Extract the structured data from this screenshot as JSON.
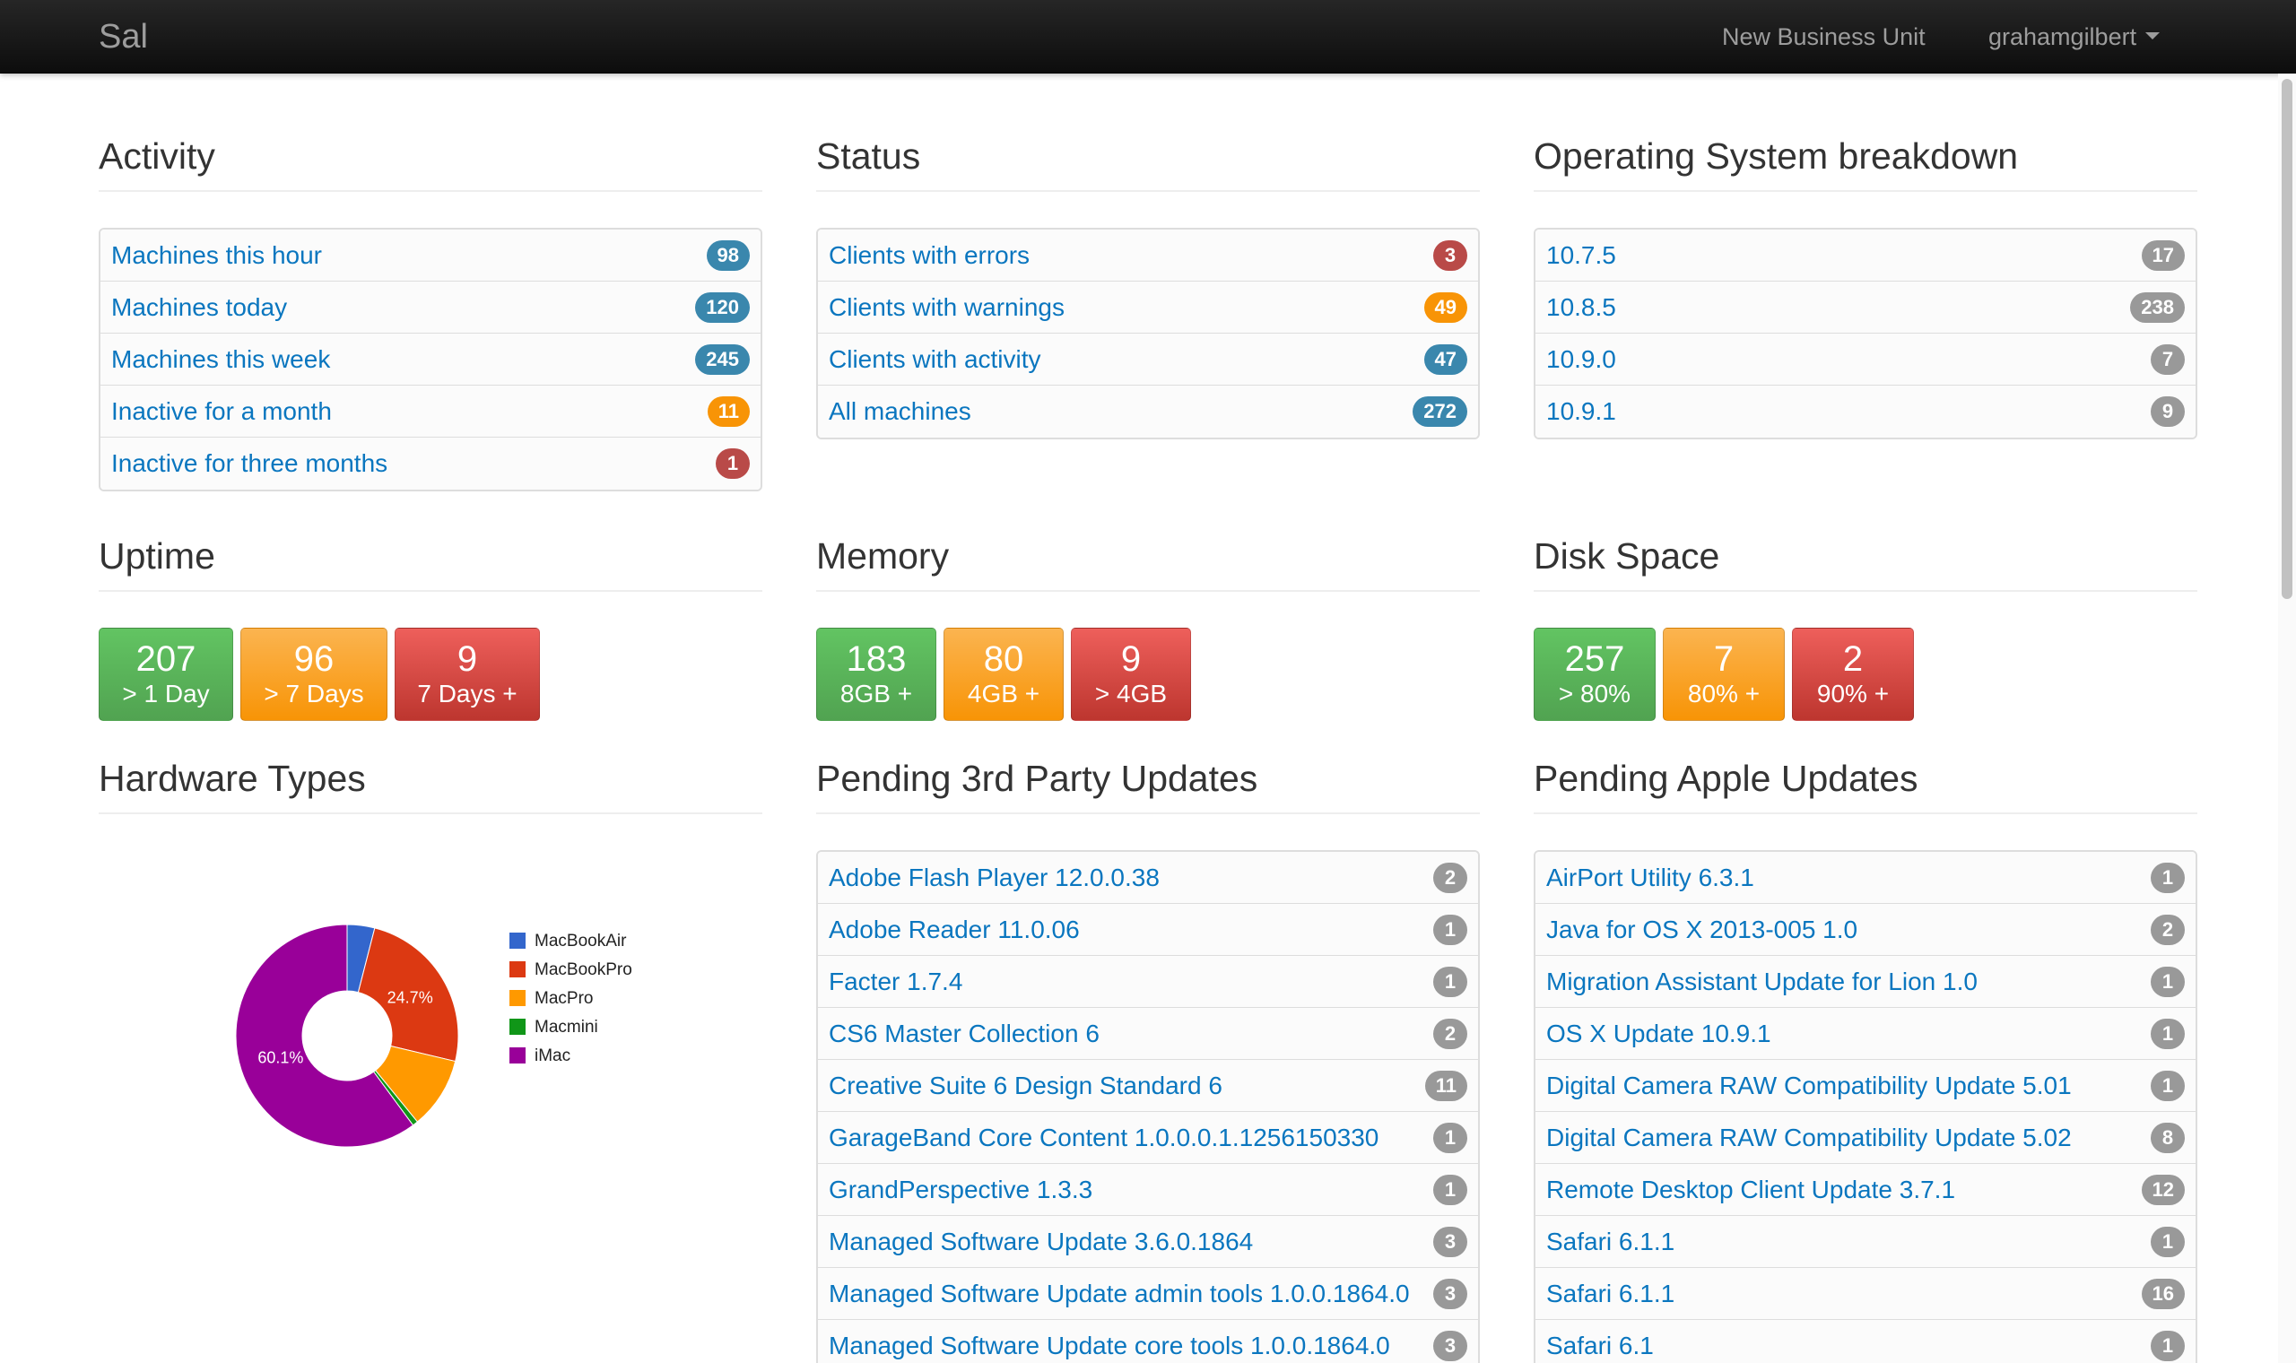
{
  "nav": {
    "brand": "Sal",
    "business_unit": "New Business Unit",
    "user": "grahamgilbert"
  },
  "activity": {
    "title": "Activity",
    "items": [
      {
        "label": "Machines this hour",
        "count": "98",
        "color": "#3a87ad"
      },
      {
        "label": "Machines today",
        "count": "120",
        "color": "#3a87ad"
      },
      {
        "label": "Machines this week",
        "count": "245",
        "color": "#3a87ad"
      },
      {
        "label": "Inactive for a month",
        "count": "11",
        "color": "#f89406"
      },
      {
        "label": "Inactive for three months",
        "count": "1",
        "color": "#b94a48"
      }
    ]
  },
  "status": {
    "title": "Status",
    "items": [
      {
        "label": "Clients with errors",
        "count": "3",
        "color": "#b94a48"
      },
      {
        "label": "Clients with warnings",
        "count": "49",
        "color": "#f89406"
      },
      {
        "label": "Clients with activity",
        "count": "47",
        "color": "#3a87ad"
      },
      {
        "label": "All machines",
        "count": "272",
        "color": "#3a87ad"
      }
    ]
  },
  "os": {
    "title": "Operating System breakdown",
    "items": [
      {
        "label": "10.7.5",
        "count": "17"
      },
      {
        "label": "10.8.5",
        "count": "238"
      },
      {
        "label": "10.9.0",
        "count": "7"
      },
      {
        "label": "10.9.1",
        "count": "9"
      }
    ]
  },
  "uptime": {
    "title": "Uptime",
    "tiles": [
      {
        "value": "207",
        "label": "> 1 Day",
        "kind": "green"
      },
      {
        "value": "96",
        "label": "> 7 Days",
        "kind": "orange"
      },
      {
        "value": "9",
        "label": "7 Days +",
        "kind": "red"
      }
    ]
  },
  "memory": {
    "title": "Memory",
    "tiles": [
      {
        "value": "183",
        "label": "8GB +",
        "kind": "green"
      },
      {
        "value": "80",
        "label": "4GB +",
        "kind": "orange"
      },
      {
        "value": "9",
        "label": "> 4GB",
        "kind": "red"
      }
    ]
  },
  "disk": {
    "title": "Disk Space",
    "tiles": [
      {
        "value": "257",
        "label": "> 80%",
        "kind": "green"
      },
      {
        "value": "7",
        "label": "80% +",
        "kind": "orange"
      },
      {
        "value": "2",
        "label": "90% +",
        "kind": "red"
      }
    ]
  },
  "hardware": {
    "title": "Hardware Types"
  },
  "third_party": {
    "title": "Pending 3rd Party Updates",
    "items": [
      {
        "label": "Adobe Flash Player 12.0.0.38",
        "count": "2"
      },
      {
        "label": "Adobe Reader 11.0.06",
        "count": "1"
      },
      {
        "label": "Facter 1.7.4",
        "count": "1"
      },
      {
        "label": "CS6 Master Collection 6",
        "count": "2"
      },
      {
        "label": "Creative Suite 6 Design Standard 6",
        "count": "11"
      },
      {
        "label": "GarageBand Core Content 1.0.0.0.1.1256150330",
        "count": "1"
      },
      {
        "label": "GrandPerspective 1.3.3",
        "count": "1"
      },
      {
        "label": "Managed Software Update 3.6.0.1864",
        "count": "3"
      },
      {
        "label": "Managed Software Update admin tools 1.0.0.1864.0",
        "count": "3"
      },
      {
        "label": "Managed Software Update core tools 1.0.0.1864.0",
        "count": "3"
      }
    ]
  },
  "apple": {
    "title": "Pending Apple Updates",
    "items": [
      {
        "label": "AirPort Utility 6.3.1",
        "count": "1"
      },
      {
        "label": "Java for OS X 2013-005 1.0",
        "count": "2"
      },
      {
        "label": "Migration Assistant Update for Lion 1.0",
        "count": "1"
      },
      {
        "label": "OS X Update 10.9.1",
        "count": "1"
      },
      {
        "label": "Digital Camera RAW Compatibility Update 5.01",
        "count": "1"
      },
      {
        "label": "Digital Camera RAW Compatibility Update 5.02",
        "count": "8"
      },
      {
        "label": "Remote Desktop Client Update 3.7.1",
        "count": "12"
      },
      {
        "label": "Safari 6.1.1",
        "count": "1"
      },
      {
        "label": "Safari 6.1.1",
        "count": "16"
      },
      {
        "label": "Safari 6.1",
        "count": "1"
      }
    ]
  },
  "chart_data": {
    "type": "pie",
    "title": "",
    "categories": [
      "MacBookAir",
      "MacBookPro",
      "MacPro",
      "Macmini",
      "iMac"
    ],
    "values": [
      4.0,
      24.7,
      10.4,
      0.8,
      60.1
    ],
    "colors": [
      "#3366cc",
      "#dc3912",
      "#ff9900",
      "#109618",
      "#990099"
    ],
    "slice_labels": [
      "",
      "24.7%",
      "",
      "",
      "60.1%"
    ],
    "legend": "right",
    "donut": true
  }
}
